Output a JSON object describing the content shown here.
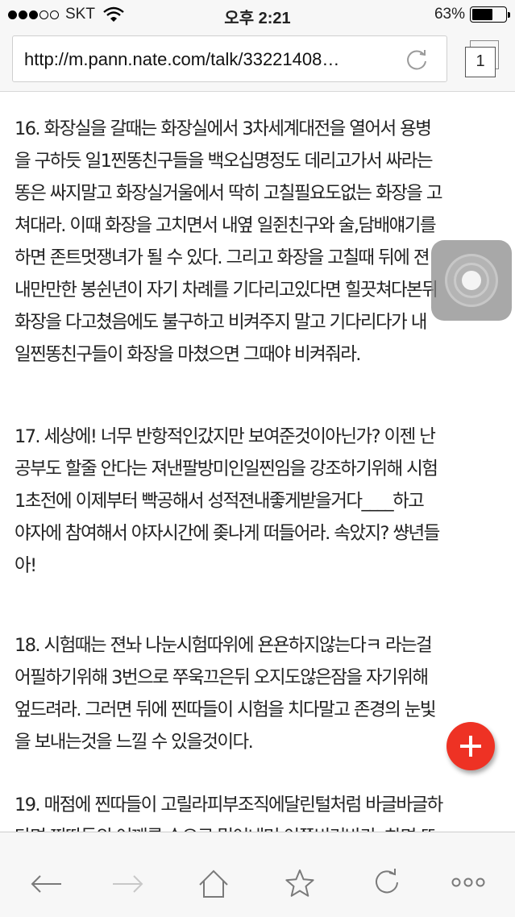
{
  "status_bar": {
    "carrier": "SKT",
    "time": "오후 2:21",
    "battery_percent_text": "63%",
    "battery_level": 0.63
  },
  "browser": {
    "url": "http://m.pann.nate.com/talk/33221408…",
    "tab_count": "1"
  },
  "article": {
    "paragraphs": [
      {
        "lines": [
          "16. 화장실을 갈때는 화장실에서 3차세계대전을 열어서 용병",
          "을 구하듯 일1찐똥친구들을 백오십명정도 데리고가서 싸라는",
          "똥은 싸지말고 화장실거울에서 딱히 고칠필요도없는 화장을 고",
          "쳐대라. 이때 화장을 고치면서 내옆 일쥔친구와 술,담배얘기를",
          "하면 존트멋쟁녀가 될 수 있다. 그리고 화장을 고칠때 뒤에 젼",
          "내만만한 봉쉰년이 자기 차례를 기다리고있다면 힐끗쳐다본뒤",
          "화장을 다고쳤음에도 불구하고 비켜주지 말고 기다리다가 내",
          "일찐똥친구들이 화장을 마쳤으면 그때야 비켜줘라."
        ]
      },
      {
        "lines": [
          "17. 세상에! 너무 반항적인갔지만 보여준것이아닌가? 이젠 난",
          "공부도 할줄 안다는 져낸팔방미인일찐임을 강조하기위해 시험",
          "1초전에 이제부터 빡공해서 성적젼내좋게받을거다____하고",
          "야자에 참여해서 야자시간에 좆나게 떠들어라. 속았지? 썅년들",
          "아!"
        ]
      },
      {
        "lines": [
          "18. 시험때는 젼놔 나눈시험따위에 욘욘하지않는다ㅋ 라는걸",
          "어필하기위해 3번으로 쭈욱끄은뒤 오지도않은잠을 자기위해",
          "엎드려라. 그러면 뒤에 찐따들이 시험을 치다말고 존경의 눈빛",
          "을 보내는것을 느낄 수 있을것이다."
        ]
      },
      {
        "lines": [
          "19. 매점에 찐따들이 고릴라피부조직에달린털처럼 바글바글하",
          "다면 찐따들의 어깨를 손으로 밀어내며 이쪽비켜바라; 하면 또"
        ]
      }
    ]
  }
}
